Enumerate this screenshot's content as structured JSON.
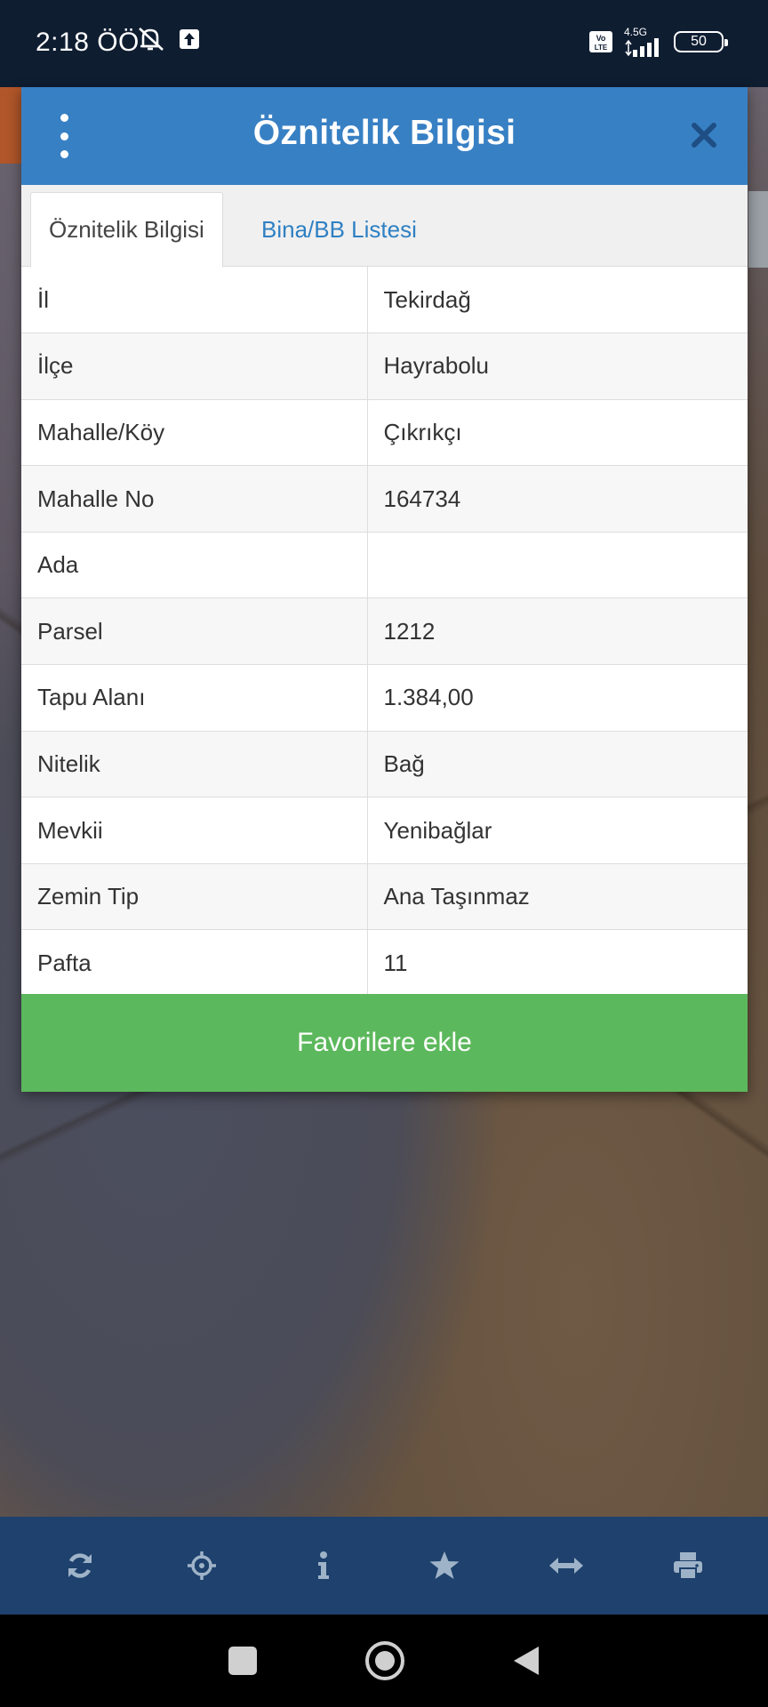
{
  "status_bar": {
    "time": "2:18 ÖÖ",
    "network_type": "4.5G",
    "battery": "50",
    "icons": [
      "mute-icon",
      "upload-icon",
      "volte-icon",
      "signal-icon",
      "battery-icon"
    ]
  },
  "dialog": {
    "title": "Öznitelik Bilgisi",
    "tabs": [
      {
        "label": "Öznitelik Bilgisi",
        "active": true
      },
      {
        "label": "Bina/BB Listesi",
        "active": false
      }
    ],
    "rows": [
      {
        "key": "İl",
        "value": "Tekirdağ"
      },
      {
        "key": "İlçe",
        "value": "Hayrabolu"
      },
      {
        "key": "Mahalle/Köy",
        "value": "Çıkrıkçı"
      },
      {
        "key": "Mahalle No",
        "value": "164734"
      },
      {
        "key": "Ada",
        "value": ""
      },
      {
        "key": "Parsel",
        "value": "1212"
      },
      {
        "key": "Tapu Alanı",
        "value": "1.384,00"
      },
      {
        "key": "Nitelik",
        "value": "Bağ"
      },
      {
        "key": "Mevkii",
        "value": "Yenibağlar"
      },
      {
        "key": "Zemin Tip",
        "value": "Ana Taşınmaz"
      },
      {
        "key": "Pafta",
        "value": "11"
      }
    ],
    "favorite_button": "Favorilere ekle"
  },
  "toolbar": {
    "items": [
      "refresh-icon",
      "locate-icon",
      "info-icon",
      "star-icon",
      "measure-icon",
      "print-icon"
    ]
  },
  "colors": {
    "header": "#3880c4",
    "favorite": "#5cb85c",
    "toolbar": "#1e416d",
    "tab_link": "#2f80c3"
  }
}
